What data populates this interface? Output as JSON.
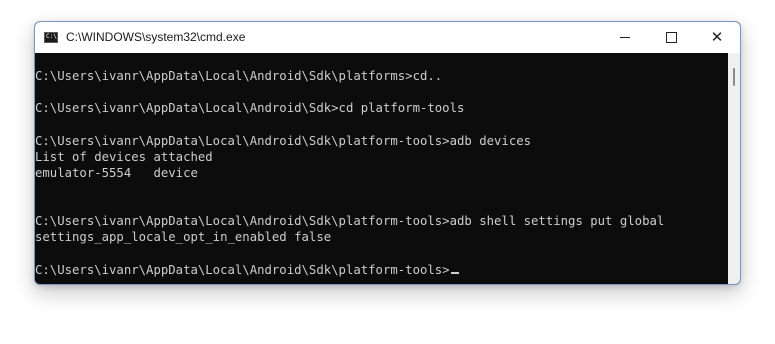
{
  "window": {
    "title": "C:\\WINDOWS\\system32\\cmd.exe",
    "icon": "cmd-console-icon"
  },
  "controls": {
    "minimize_icon": "minimize-icon",
    "maximize_icon": "maximize-icon",
    "close_icon": "close-icon",
    "close_glyph": "✕"
  },
  "app_icon": {
    "text": "C:\\"
  },
  "terminal": {
    "lines": [
      "C:\\Users\\ivanr\\AppData\\Local\\Android\\Sdk\\platforms>cd..",
      "C:\\Users\\ivanr\\AppData\\Local\\Android\\Sdk>cd platform-tools",
      "C:\\Users\\ivanr\\AppData\\Local\\Android\\Sdk\\platform-tools>adb devices",
      "List of devices attached",
      "emulator-5554   device",
      "C:\\Users\\ivanr\\AppData\\Local\\Android\\Sdk\\platform-tools>adb shell settings put global",
      "settings_app_locale_opt_in_enabled false",
      "C:\\Users\\ivanr\\AppData\\Local\\Android\\Sdk\\platform-tools>"
    ]
  },
  "colors": {
    "terminal_bg": "#0c0c0c",
    "terminal_text": "#cccccc",
    "window_border": "#7a98bf"
  }
}
